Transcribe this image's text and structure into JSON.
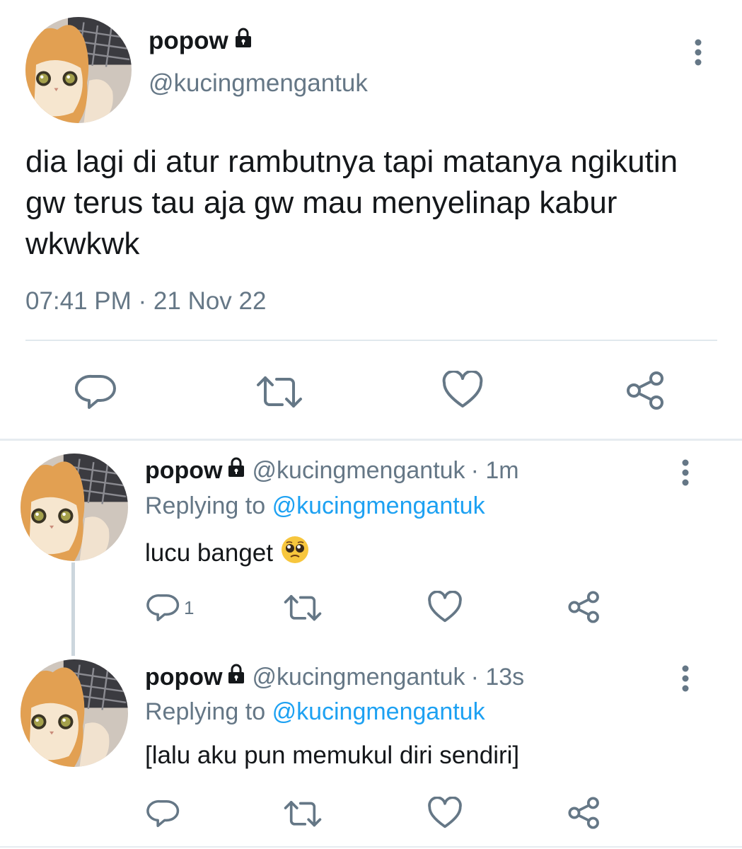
{
  "main_tweet": {
    "display_name": "popow",
    "handle": "@kucingmengantuk",
    "text": "dia lagi di atur rambutnya tapi matanya ngikutin gw terus tau aja gw mau menyelinap kabur wkwkwk",
    "timestamp": "07:41 PM · 21 Nov 22"
  },
  "replies": [
    {
      "display_name": "popow",
      "handle": "@kucingmengantuk",
      "time": "· 1m",
      "replying_label": "Replying to",
      "replying_to": "@kucingmengantuk",
      "text": "lucu banget",
      "emoji": "pleading-face-emoji",
      "reply_count": "1"
    },
    {
      "display_name": "popow",
      "handle": "@kucingmengantuk",
      "time": "· 13s",
      "replying_label": "Replying to",
      "replying_to": "@kucingmengantuk",
      "text": "[lalu aku pun memukul diri sendiri]",
      "reply_count": ""
    }
  ],
  "icons": {
    "reply": "reply-icon",
    "retweet": "retweet-icon",
    "like": "heart-icon",
    "share": "share-icon",
    "more": "more-vertical-icon",
    "lock": "lock-icon"
  },
  "colors": {
    "text": "#14171a",
    "muted": "#657786",
    "link": "#1da1f2",
    "divider": "#e1e8ed"
  }
}
